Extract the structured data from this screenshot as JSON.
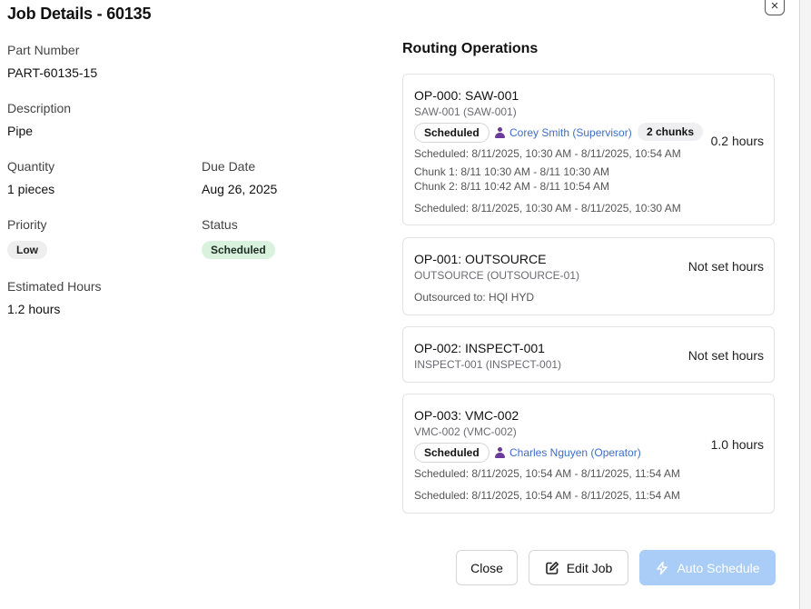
{
  "dialog": {
    "title": "Job Details - 60135",
    "close_glyph": "×"
  },
  "details": {
    "part_number_label": "Part Number",
    "part_number": "PART-60135-15",
    "description_label": "Description",
    "description": "Pipe",
    "quantity_label": "Quantity",
    "quantity": "1 pieces",
    "due_date_label": "Due Date",
    "due_date": "Aug 26, 2025",
    "priority_label": "Priority",
    "priority": "Low",
    "status_label": "Status",
    "status": "Scheduled",
    "est_hours_label": "Estimated Hours",
    "est_hours": "1.2 hours"
  },
  "routing": {
    "title": "Routing Operations",
    "ops": [
      {
        "title": "OP-000: SAW-001",
        "sub": "SAW-001 (SAW-001)",
        "hours": "0.2 hours",
        "status": "Scheduled",
        "assignee": "Corey Smith (Supervisor)",
        "chunks_badge": "2 chunks",
        "scheduled": "Scheduled: 8/11/2025, 10:30 AM - 8/11/2025, 10:54 AM",
        "chunk1": "Chunk 1: 8/11 10:30 AM - 8/11 10:30 AM",
        "chunk2": "Chunk 2: 8/11 10:42 AM - 8/11 10:54 AM",
        "scheduled2": "Scheduled: 8/11/2025, 10:30 AM - 8/11/2025, 10:30 AM"
      },
      {
        "title": "OP-001: OUTSOURCE",
        "sub": "OUTSOURCE (OUTSOURCE-01)",
        "hours": "Not set hours",
        "outsourced": "Outsourced to: HQI HYD"
      },
      {
        "title": "OP-002: INSPECT-001",
        "sub": "INSPECT-001 (INSPECT-001)",
        "hours": "Not set hours"
      },
      {
        "title": "OP-003: VMC-002",
        "sub": "VMC-002 (VMC-002)",
        "hours": "1.0 hours",
        "status": "Scheduled",
        "assignee": "Charles Nguyen (Operator)",
        "scheduled": "Scheduled: 8/11/2025, 10:54 AM - 8/11/2025, 11:54 AM",
        "scheduled2": "Scheduled: 8/11/2025, 10:54 AM - 8/11/2025, 11:54 AM"
      }
    ]
  },
  "footer": {
    "close_label": "Close",
    "edit_label": "Edit Job",
    "auto_label": "Auto Schedule"
  },
  "colors": {
    "primary_disabled": "#a9cdf6",
    "scheduled_badge_bg": "#d9f2de",
    "assignee_link": "#3b6ec8",
    "person_icon": "#6a3b9c"
  },
  "icons": {
    "close": "close-icon",
    "person": "person-icon",
    "edit": "edit-icon",
    "bolt": "lightning-icon"
  }
}
